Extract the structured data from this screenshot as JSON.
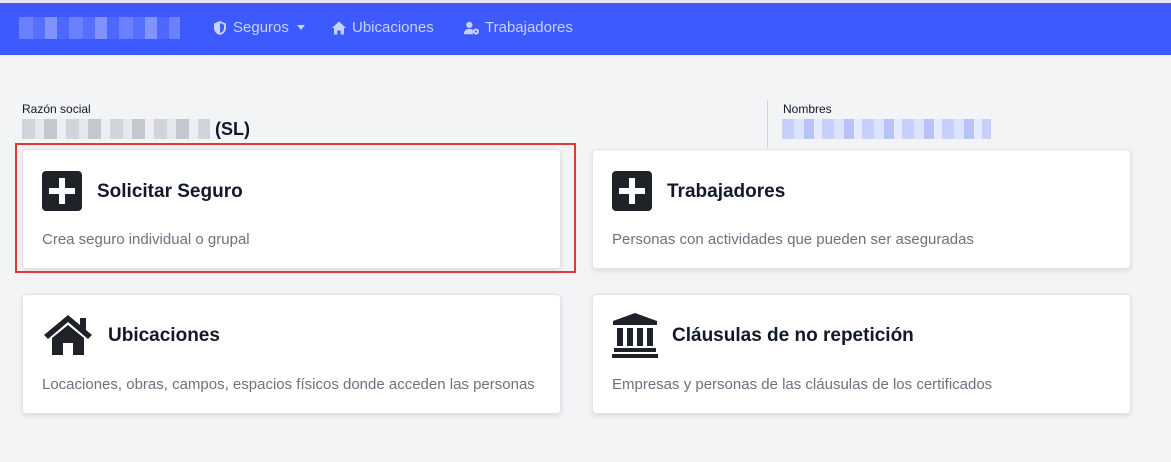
{
  "navbar": {
    "items": [
      {
        "label": "Seguros",
        "icon": "shield-icon",
        "dropdown": true
      },
      {
        "label": "Ubicaciones",
        "icon": "home-icon"
      },
      {
        "label": "Trabajadores",
        "icon": "user-gear-icon"
      }
    ]
  },
  "company": {
    "razon_label": "Razón social",
    "razon_suffix": "(SL)",
    "nombres_label": "Nombres"
  },
  "cards": [
    {
      "title": "Solicitar Seguro",
      "description": "Crea seguro individual o grupal",
      "icon": "plus-square-icon"
    },
    {
      "title": "Trabajadores",
      "description": "Personas con actividades que pueden ser aseguradas",
      "icon": "plus-square-icon"
    },
    {
      "title": "Ubicaciones",
      "description": "Locaciones, obras, campos, espacios físicos donde acceden las personas",
      "icon": "home-icon"
    },
    {
      "title": "Cláusulas de no repetición",
      "description": "Empresas y personas de las cláusulas de los certificados",
      "icon": "landmark-icon"
    }
  ],
  "colors": {
    "navbar": "#3d5afe",
    "highlight": "#e53935",
    "background": "#f3f4f6"
  }
}
